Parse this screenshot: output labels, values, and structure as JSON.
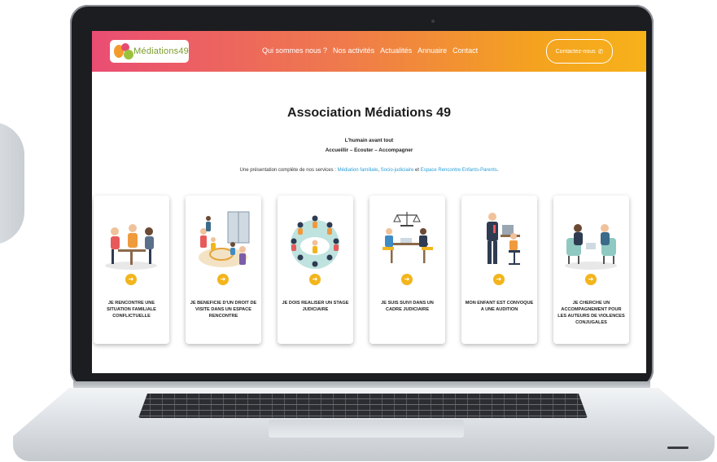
{
  "site": {
    "logo_text": "Médiations49",
    "nav": [
      "Qui sommes nous ?",
      "Nos activités",
      "Actualités",
      "Annuaire",
      "Contact"
    ],
    "contact_button": "Contactez-nous",
    "title": "Association Médiations 49",
    "tagline": "L'humain avant tout",
    "values": "Accueillir – Ecouter – Accompagner",
    "intro": {
      "prefix": "Une  présentation complète de nos services  : ",
      "link1": "Médiation familiale",
      "sep": ", ",
      "link2": "Socio-judiciaire",
      "and": " et ",
      "link3": "Espace Rencontre Enfants-Parents",
      "suffix": "."
    },
    "cards": [
      {
        "label": "JE RENCONTRE UNE SITUATION FAMILIALE CONFLICTUELLE",
        "icon": "family-conflict-illustration"
      },
      {
        "label": "JE BENEFICIE D'UN DROIT DE VISITE DANS UN ESPACE RENCONTRE",
        "icon": "visitation-space-illustration"
      },
      {
        "label": "JE DOIS REALISER UN STAGE JUDICIAIRE",
        "icon": "judicial-workshop-illustration"
      },
      {
        "label": "JE SUIS SUIVI DANS UN CADRE JUDICIAIRE",
        "icon": "judicial-followup-illustration"
      },
      {
        "label": "MON ENFANT EST CONVOQUE A UNE AUDITION",
        "icon": "child-hearing-illustration"
      },
      {
        "label": "JE CHERCHE UN ACCOMPAGNEMENT POUR LES AUTEURS DE VIOLENCES CONJUGALES",
        "icon": "counseling-illustration"
      }
    ],
    "arrow_glyph": "➜",
    "colors": {
      "header_start": "#ea4d73",
      "header_end": "#f7b21a",
      "accent_yellow": "#f2b51d",
      "link_blue": "#2a9fd6"
    }
  }
}
